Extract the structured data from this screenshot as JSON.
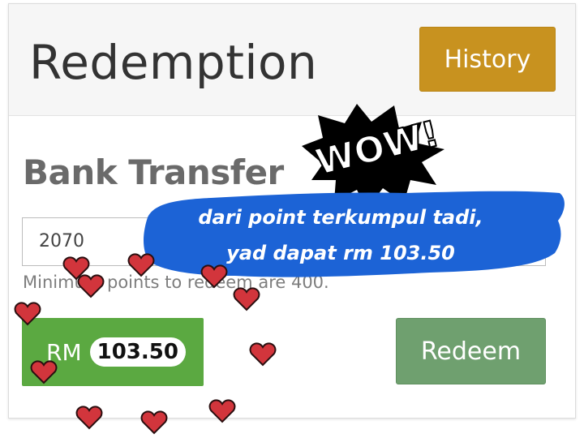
{
  "header": {
    "title": "Redemption",
    "history_label": "History"
  },
  "section": {
    "title": "Bank Transfer"
  },
  "points_input": {
    "value": "2070"
  },
  "hint": "Minimum points to redeem are 400.",
  "amount": {
    "prefix": "RM",
    "value": "103.50"
  },
  "redeem_label": "Redeem",
  "sticker": {
    "wow": "WOW!",
    "caption_line1": "dari point terkumpul tadi,",
    "caption_line2": "yad dapat rm 103.50"
  },
  "colors": {
    "history": "#c8921f",
    "amount": "#5ba941",
    "redeem": "#6fa06f",
    "caption_bg": "#1c63d6",
    "heart": "#d2353c"
  }
}
